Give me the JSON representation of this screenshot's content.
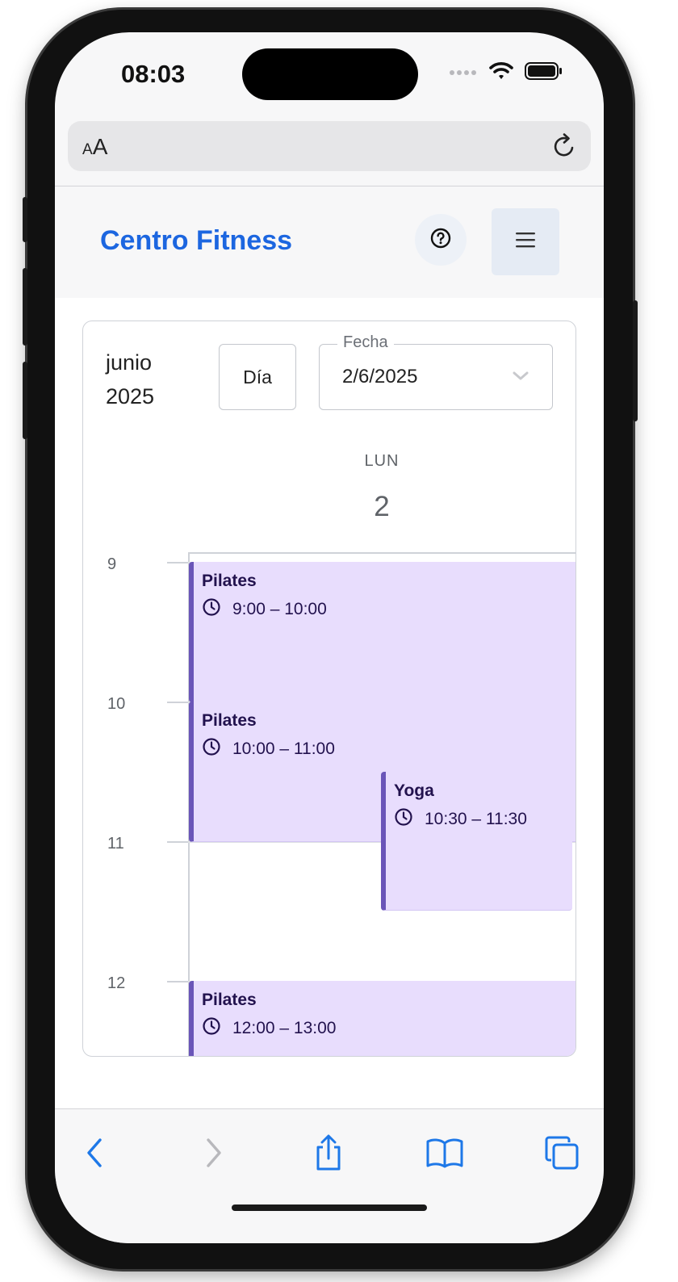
{
  "device": {
    "status_time": "08:03"
  },
  "browser": {
    "text_size_label_small": "A",
    "text_size_label_large": "A"
  },
  "app": {
    "title": "Centro Fitness",
    "brand_color": "#1c66e0"
  },
  "calendar": {
    "month": "junio",
    "year": "2025",
    "view_button": "Día",
    "date_field_label": "Fecha",
    "date_field_value": "2/6/2025",
    "day_name": "LUN",
    "day_number": "2",
    "hours": [
      "9",
      "10",
      "11",
      "12"
    ],
    "event_color": "#e8ddfd",
    "event_accent": "#6a55b8",
    "events": [
      {
        "title": "Pilates",
        "time": "9:00 – 10:00"
      },
      {
        "title": "Pilates",
        "time": "10:00 – 11:00"
      },
      {
        "title": "Yoga",
        "time": "10:30 – 11:30"
      },
      {
        "title": "Pilates",
        "time": "12:00 – 13:00"
      }
    ]
  },
  "toolbar": {
    "icons": [
      "back-icon",
      "forward-icon",
      "share-icon",
      "bookmarks-icon",
      "tabs-icon"
    ]
  }
}
